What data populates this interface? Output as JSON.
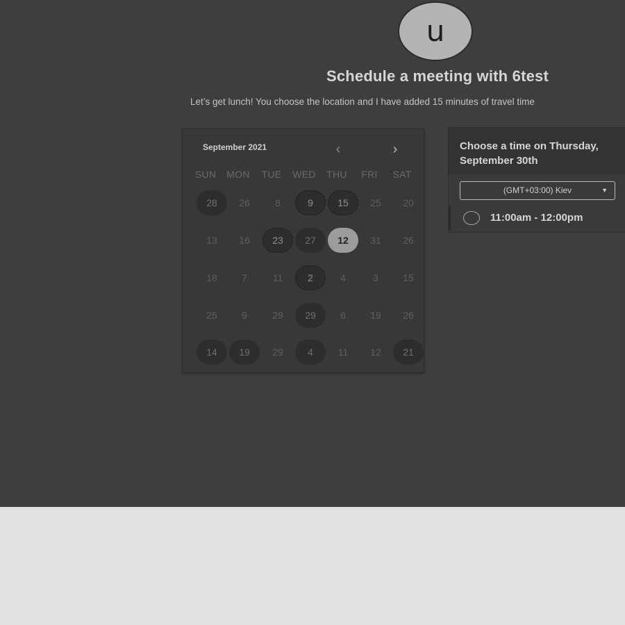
{
  "host": {
    "avatar_letter": "u",
    "title": "Schedule a meeting with 6test",
    "description": "Let’s get lunch! You choose the location and I have added 15 minutes of travel time"
  },
  "calendar": {
    "month_label": "September 2021",
    "prev_icon": "‹",
    "next_icon": "›",
    "weekdays": [
      "SUN",
      "MON",
      "TUE",
      "WED",
      "THU",
      "FRI",
      "SAT"
    ],
    "weeks": [
      [
        {
          "label": "28",
          "state": "available"
        },
        {
          "label": "26",
          "state": "disabled"
        },
        {
          "label": "8",
          "state": "disabled"
        },
        {
          "label": "9",
          "state": "available-alt"
        },
        {
          "label": "15",
          "state": "available-alt"
        },
        {
          "label": "25",
          "state": "disabled"
        },
        {
          "label": "20",
          "state": "disabled"
        }
      ],
      [
        {
          "label": "13",
          "state": "disabled"
        },
        {
          "label": "16",
          "state": "disabled"
        },
        {
          "label": "23",
          "state": "available-alt"
        },
        {
          "label": "27",
          "state": "available"
        },
        {
          "label": "12",
          "state": "selected"
        },
        {
          "label": "31",
          "state": "disabled"
        },
        {
          "label": "26",
          "state": "disabled"
        }
      ],
      [
        {
          "label": "18",
          "state": "disabled"
        },
        {
          "label": "7",
          "state": "disabled"
        },
        {
          "label": "11",
          "state": "disabled"
        },
        {
          "label": "2",
          "state": "available-alt"
        },
        {
          "label": "4",
          "state": "disabled"
        },
        {
          "label": "3",
          "state": "disabled"
        },
        {
          "label": "15",
          "state": "disabled"
        }
      ],
      [
        {
          "label": "25",
          "state": "disabled"
        },
        {
          "label": "9",
          "state": "disabled"
        },
        {
          "label": "29",
          "state": "disabled"
        },
        {
          "label": "29",
          "state": "available"
        },
        {
          "label": "6",
          "state": "disabled"
        },
        {
          "label": "19",
          "state": "disabled"
        },
        {
          "label": "26",
          "state": "disabled"
        }
      ],
      [
        {
          "label": "14",
          "state": "available"
        },
        {
          "label": "19",
          "state": "available"
        },
        {
          "label": "29",
          "state": "disabled"
        },
        {
          "label": "4",
          "state": "available"
        },
        {
          "label": "11",
          "state": "disabled"
        },
        {
          "label": "12",
          "state": "disabled"
        },
        {
          "label": "21",
          "state": "available"
        }
      ]
    ]
  },
  "time_panel": {
    "heading_line1": "Choose a time on Thursday,",
    "heading_line2": "September 30th",
    "timezone": "(GMT+03:00) Kiev",
    "timezone_arrow": "▼",
    "slots": [
      {
        "label": "11:00am - 12:00pm"
      }
    ]
  }
}
